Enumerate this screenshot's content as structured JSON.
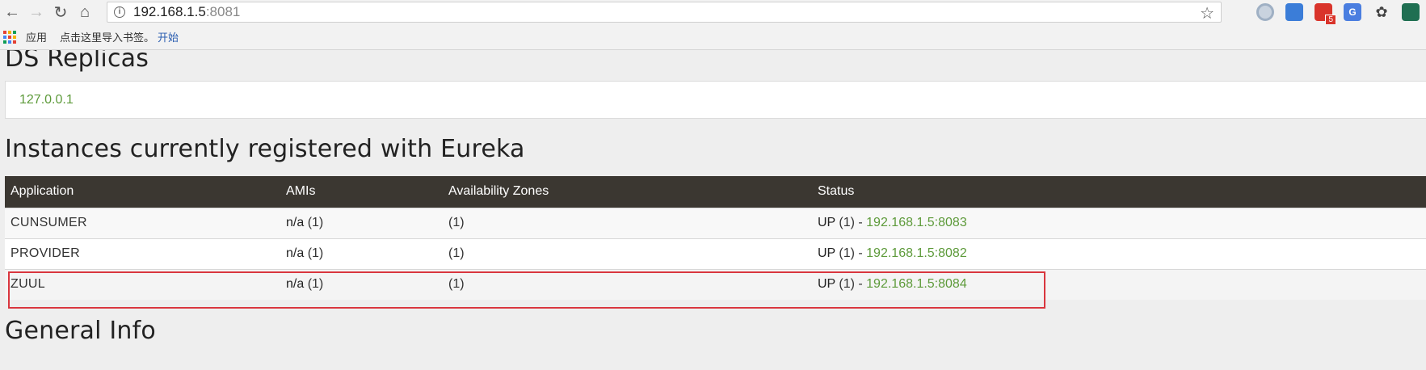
{
  "browser": {
    "address": {
      "host": "192.168.1.5",
      "port": ":8081"
    },
    "bookmarks": {
      "apps_label": "应用",
      "hint": "点击这里导入书签。",
      "start_link": "开始"
    },
    "extensions": {
      "mail_badge": "5",
      "translate_label": "G"
    }
  },
  "page": {
    "replicas_heading": "DS Replicas",
    "replica_host": "127.0.0.1",
    "instances_heading": "Instances currently registered with Eureka",
    "next_heading": "General Info",
    "table": {
      "headers": [
        "Application",
        "AMIs",
        "Availability Zones",
        "Status"
      ],
      "rows": [
        {
          "app": "CUNSUMER",
          "ami_value": "n/a",
          "ami_count": " (1)",
          "zones": "(1)",
          "status": "UP",
          "status_count": " (1) - ",
          "instance": "192.168.1.5:8083"
        },
        {
          "app": "PROVIDER",
          "ami_value": "n/a",
          "ami_count": " (1)",
          "zones": "(1)",
          "status": "UP",
          "status_count": " (1) - ",
          "instance": "192.168.1.5:8082"
        },
        {
          "app": "ZUUL",
          "ami_value": "n/a",
          "ami_count": " (1)",
          "zones": "(1)",
          "status": "UP",
          "status_count": " (1) - ",
          "instance": "192.168.1.5:8084"
        }
      ]
    }
  },
  "colors": {
    "header_bg": "#3b3731",
    "link_green": "#5d9a3a",
    "highlight_red": "#d9363e"
  },
  "icons": {
    "back": "arrow-left-icon",
    "forward": "arrow-right-icon",
    "reload": "reload-icon",
    "home": "home-icon",
    "info": "info-icon",
    "bookmark": "star-icon",
    "apps": "apps-grid-icon"
  }
}
